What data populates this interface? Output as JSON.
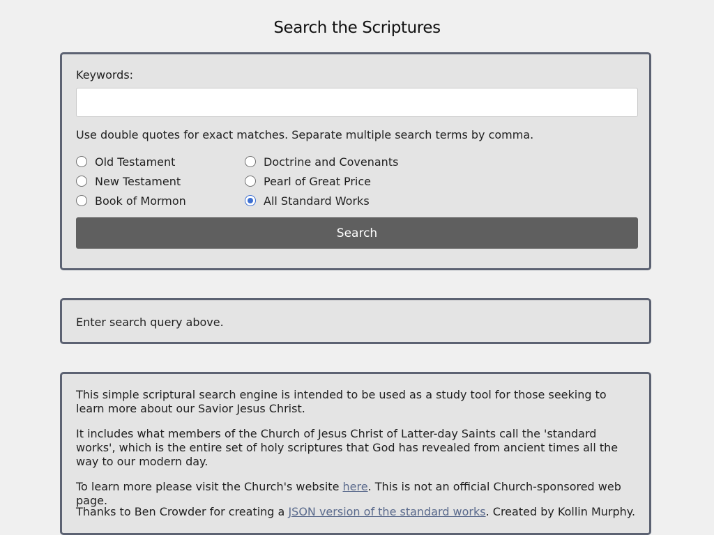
{
  "page": {
    "title": "Search the Scriptures"
  },
  "search": {
    "keywords_label": "Keywords:",
    "keywords_value": "",
    "hint": "Use double quotes for exact matches. Separate multiple search terms by comma.",
    "options": [
      {
        "label": "Old Testament",
        "checked": false
      },
      {
        "label": "New Testament",
        "checked": false
      },
      {
        "label": "Book of Mormon",
        "checked": false
      },
      {
        "label": "Doctrine and Covenants",
        "checked": false
      },
      {
        "label": "Pearl of Great Price",
        "checked": false
      },
      {
        "label": "All Standard Works",
        "checked": true
      }
    ],
    "button_label": "Search"
  },
  "status": {
    "text": "Enter search query above."
  },
  "about": {
    "p1": "This simple scriptural search engine is intended to be used as a study tool for those seeking to learn more about our Savior Jesus Christ.",
    "p2": "It includes what members of the Church of Jesus Christ of Latter-day Saints call the 'standard works', which is the entire set of holy scriptures that God has revealed from ancient times all the way to our modern day.",
    "p3_before": "To learn more please visit the Church's website ",
    "p3_link": "here",
    "p3_after": ". This is not an official Church-sponsored web page.",
    "p4_before": "Thanks to Ben Crowder for creating a ",
    "p4_link": "JSON version of the standard works",
    "p4_after": ". Created by Kollin Murphy."
  },
  "colors": {
    "background": "#f0f0f0",
    "panel": "#e4e4e4",
    "panel_border": "#5c6272",
    "button": "#5f5f5f",
    "radio_accent": "#3d6fd1",
    "link": "#5a6a8c"
  }
}
